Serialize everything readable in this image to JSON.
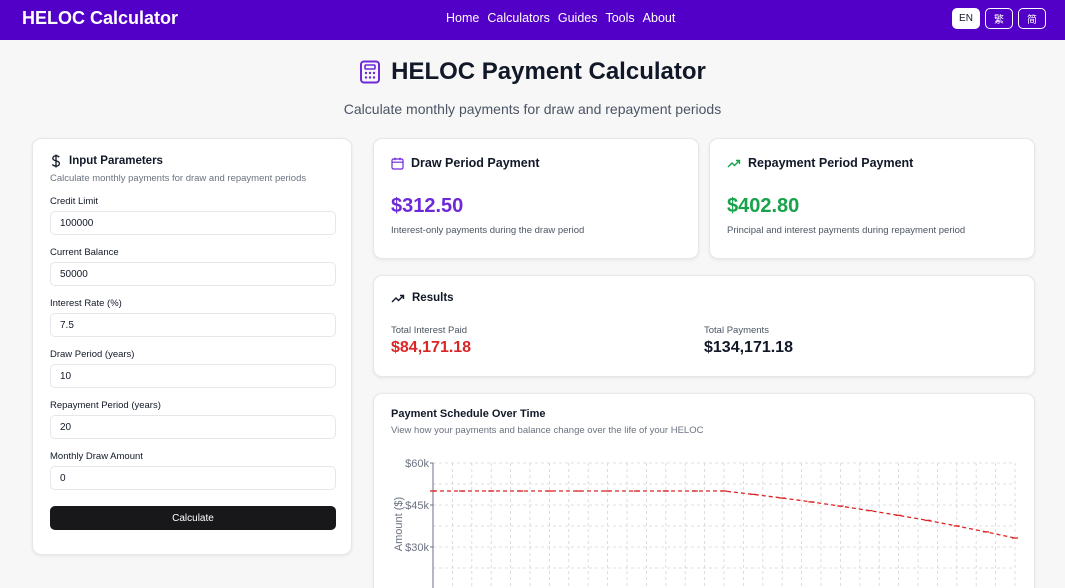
{
  "nav": {
    "brand": "HELOC Calculator",
    "links": [
      "Home",
      "Calculators",
      "Guides",
      "Tools",
      "About"
    ],
    "languages": [
      "EN",
      "繁",
      "简"
    ],
    "active_language": "EN"
  },
  "hero": {
    "icon": "calculator-icon",
    "title": "HELOC Payment Calculator",
    "subtitle": "Calculate monthly payments for draw and repayment periods"
  },
  "inputs": {
    "icon": "dollar-icon",
    "title": "Input Parameters",
    "description": "Calculate monthly payments for draw and repayment periods",
    "fields": [
      {
        "label": "Credit Limit",
        "value": "100000"
      },
      {
        "label": "Current Balance",
        "value": "50000"
      },
      {
        "label": "Interest Rate (%)",
        "value": "7.5"
      },
      {
        "label": "Draw Period (years)",
        "value": "10"
      },
      {
        "label": "Repayment Period (years)",
        "value": "20"
      },
      {
        "label": "Monthly Draw Amount",
        "value": "0"
      }
    ],
    "button": "Calculate"
  },
  "draw": {
    "icon": "calendar-icon",
    "title": "Draw Period Payment",
    "amount": "$312.50",
    "description": "Interest-only payments during the draw period",
    "color": "#6d28d9"
  },
  "repay": {
    "icon": "trending-up-icon",
    "title": "Repayment Period Payment",
    "amount": "$402.80",
    "description": "Principal and interest payments during repayment period",
    "color": "#16a34a"
  },
  "results": {
    "icon": "trending-up-icon",
    "title": "Results",
    "total_interest_label": "Total Interest Paid",
    "total_interest_value": "$84,171.18",
    "total_interest_color": "#dc2626",
    "total_payments_label": "Total Payments",
    "total_payments_value": "$134,171.18"
  },
  "chart": {
    "title": "Payment Schedule Over Time",
    "description": "View how your payments and balance change over the life of your HELOC"
  },
  "chart_data": {
    "type": "line",
    "ylabel": "Amount ($)",
    "xlabel": "",
    "yticks": [
      "$60k",
      "$45k",
      "$30k"
    ],
    "ylim": [
      0,
      60000
    ],
    "grid": true,
    "series": [
      {
        "color": "#dc2626",
        "style": "dashed with markers",
        "x": [
          0,
          1,
          2,
          3,
          4,
          5,
          6,
          7,
          8,
          9,
          10,
          11,
          12,
          13,
          14,
          15,
          16,
          17,
          18,
          19,
          20
        ],
        "values": [
          50000,
          50000,
          50000,
          50000,
          50000,
          50000,
          50000,
          50000,
          50000,
          50000,
          50000,
          48800,
          47500,
          46100,
          44600,
          43000,
          41300,
          39500,
          37500,
          35400,
          33200
        ]
      }
    ]
  }
}
